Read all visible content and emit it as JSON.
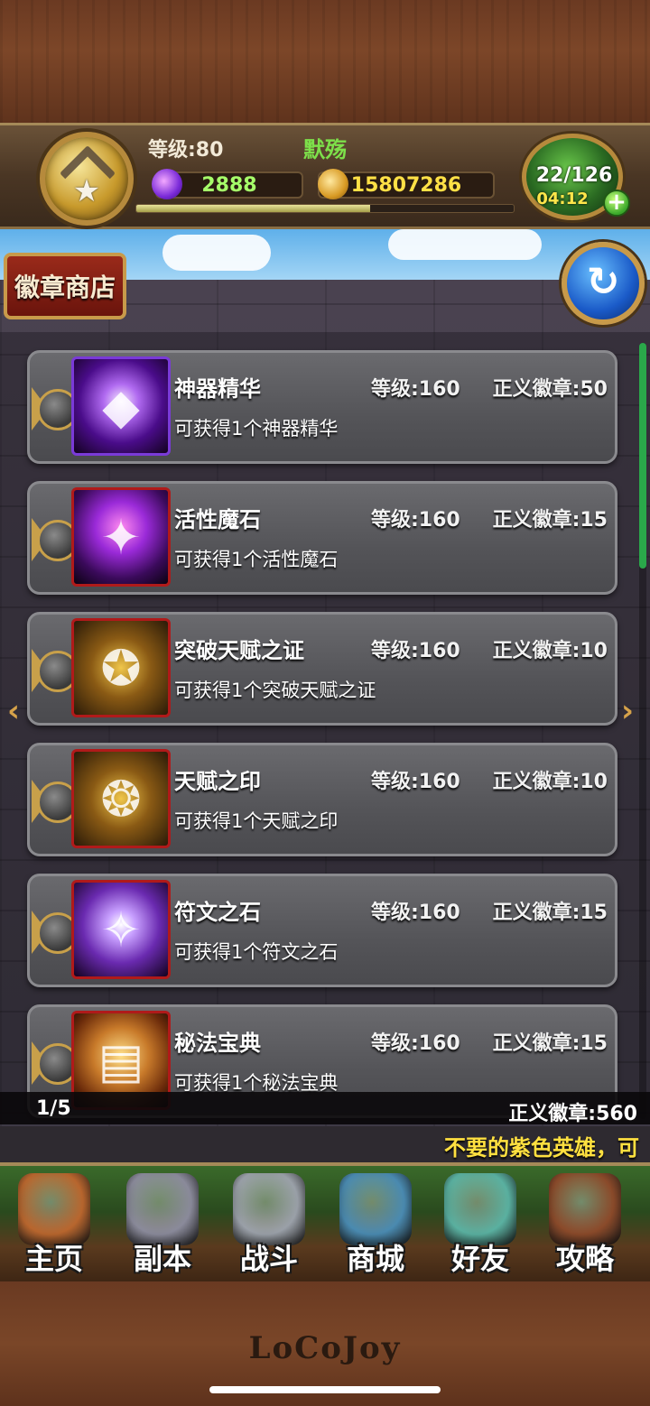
{
  "player": {
    "level_text": "等级:80",
    "name": "默殇",
    "gems": "2888",
    "gold": "15807286",
    "exp_fraction": 0.62,
    "energy": "22/126",
    "energy_timer": "04:12",
    "plus_label": "+"
  },
  "shop": {
    "title": "徽章商店",
    "refresh_icon": "refresh-icon",
    "items": [
      {
        "name": "神器精华",
        "desc": "可获得1个神器精华",
        "level": "等级:160",
        "price": "正义徽章:50",
        "icon": "artifact-essence-icon"
      },
      {
        "name": "活性魔石",
        "desc": "可获得1个活性魔石",
        "level": "等级:160",
        "price": "正义徽章:15",
        "icon": "active-magic-stone-icon"
      },
      {
        "name": "突破天赋之证",
        "desc": "可获得1个突破天赋之证",
        "level": "等级:160",
        "price": "正义徽章:10",
        "icon": "talent-breakthrough-proof-icon"
      },
      {
        "name": "天赋之印",
        "desc": "可获得1个天赋之印",
        "level": "等级:160",
        "price": "正义徽章:10",
        "icon": "talent-seal-icon"
      },
      {
        "name": "符文之石",
        "desc": "可获得1个符文之石",
        "level": "等级:160",
        "price": "正义徽章:15",
        "icon": "rune-stone-icon"
      },
      {
        "name": "秘法宝典",
        "desc": "可获得1个秘法宝典",
        "level": "等级:160",
        "price": "正义徽章:15",
        "icon": "arcane-tome-icon"
      }
    ],
    "page": "1/5",
    "badge_total": "正义徽章:560"
  },
  "ticker": "不要的紫色英雄，可",
  "nav": [
    {
      "label": "主页",
      "icon": "home-icon",
      "color": "#b8662e"
    },
    {
      "label": "副本",
      "icon": "dungeon-icon",
      "color": "#8a8a9a"
    },
    {
      "label": "战斗",
      "icon": "battle-icon",
      "color": "#9aa0a8"
    },
    {
      "label": "商城",
      "icon": "shop-icon",
      "color": "#4a8ab0"
    },
    {
      "label": "好友",
      "icon": "friends-icon",
      "color": "#5ab0a0"
    },
    {
      "label": "攻略",
      "icon": "guide-icon",
      "color": "#8a4a2a"
    }
  ],
  "brand": "LoCoJoy"
}
